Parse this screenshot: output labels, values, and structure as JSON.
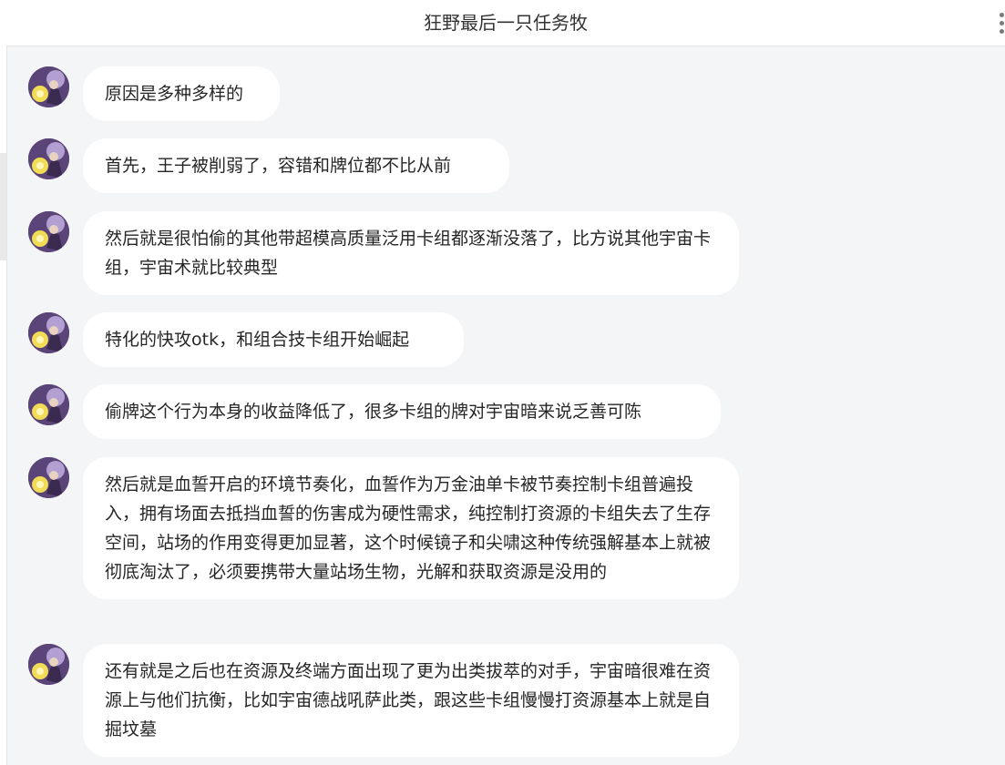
{
  "header": {
    "title": "狂野最后一只任务牧"
  },
  "messages": [
    {
      "text": "原因是多种多样的"
    },
    {
      "text": "首先，王子被削弱了，容错和牌位都不比从前"
    },
    {
      "text": "然后就是很怕偷的其他带超模高质量泛用卡组都逐渐没落了，比方说其他宇宙卡组，宇宙术就比较典型"
    },
    {
      "text": "特化的快攻otk，和组合技卡组开始崛起"
    },
    {
      "text": "偷牌这个行为本身的收益降低了，很多卡组的牌对宇宙暗来说乏善可陈"
    },
    {
      "text": "然后就是血誓开启的环境节奏化，血誓作为万金油单卡被节奏控制卡组普遍投入，拥有场面去抵挡血誓的伤害成为硬性需求，纯控制打资源的卡组失去了生存空间，站场的作用变得更加显著，这个时候镜子和尖啸这种传统强解基本上就被彻底淘汰了，必须要携带大量站场生物，光解和获取资源是没用的"
    },
    {
      "text": "还有就是之后也在资源及终端方面出现了更为出类拔萃的对手，宇宙暗很难在资源上与他们抗衡，比如宇宙德战吼萨此类，跟这些卡组慢慢打资源基本上就是自掘坟墓"
    }
  ]
}
